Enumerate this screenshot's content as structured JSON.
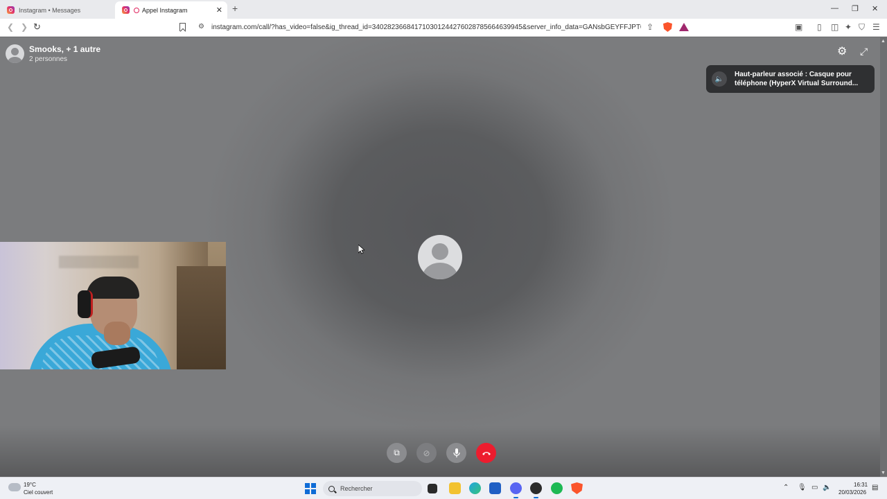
{
  "browser": {
    "tabs": [
      {
        "label": "Instagram • Messages",
        "active": false
      },
      {
        "label": "Appel Instagram",
        "active": true
      }
    ],
    "url": "instagram.com/call/?has_video=false&ig_thread_id=340282366841710301244276028785664639945&server_info_data=GANsbGEYFFJPT006ODk5ND..."
  },
  "call": {
    "participants_title": "Smooks, + 1 autre",
    "participants_count": "2 personnes",
    "toast_text": "Haut-parleur associé : Casque pour téléphone (HyperX Virtual Surround..."
  },
  "icons": {
    "settings": "gear-icon",
    "fullscreen": "expand-icon",
    "speaker": "speaker-icon",
    "screen_share": "screen-share-icon",
    "camera": "camera-off-icon",
    "microphone": "microphone-icon",
    "end_call": "end-call-icon"
  },
  "colors": {
    "end_call": "#ed1c2e",
    "call_background": "#6c6d6f",
    "toast_background": "#2f3032"
  },
  "taskbar": {
    "weather_temp": "19°C",
    "weather_desc": "Ciel couvert",
    "search_placeholder": "Rechercher",
    "time": "16:31",
    "date": "20/03/2026"
  }
}
